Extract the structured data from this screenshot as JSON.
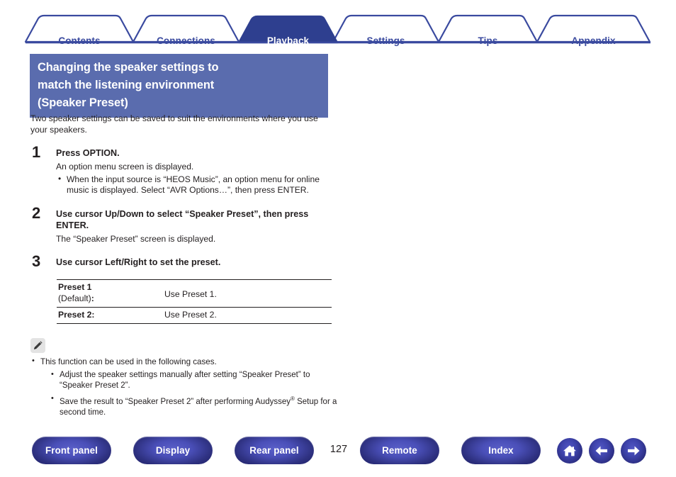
{
  "tabs": [
    {
      "label": "Contents",
      "active": false
    },
    {
      "label": "Connections",
      "active": false
    },
    {
      "label": "Playback",
      "active": true
    },
    {
      "label": "Settings",
      "active": false
    },
    {
      "label": "Tips",
      "active": false
    },
    {
      "label": "Appendix",
      "active": false
    }
  ],
  "title": {
    "line1": "Changing the speaker settings to",
    "line2": "match the listening environment",
    "line3": "(Speaker Preset)"
  },
  "intro": "Two speaker settings can be saved to suit the environments where you use your speakers.",
  "steps": [
    {
      "number": "1",
      "heading": "Press OPTION.",
      "sub": "An option menu screen is displayed.",
      "bullets": [
        "When the input source is “HEOS Music”, an option menu for online music is displayed. Select “AVR Options…”, then press ENTER."
      ]
    },
    {
      "number": "2",
      "heading": "Use cursor Up/Down to select “Speaker Preset”, then press ENTER.",
      "sub": "The “Speaker Preset” screen is displayed.",
      "bullets": []
    },
    {
      "number": "3",
      "heading": "Use cursor Left/Right to set the preset.",
      "sub": "",
      "bullets": []
    }
  ],
  "preset_table": {
    "rows": [
      {
        "key_bold": "Preset 1",
        "key_regular": "(Default)",
        "key_suffix": ":",
        "value": "Use Preset 1."
      },
      {
        "key_bold": "Preset 2:",
        "key_regular": "",
        "key_suffix": "",
        "value": "Use Preset 2."
      }
    ]
  },
  "note": {
    "icon": "pencil-icon",
    "lead": "This function can be used in the following cases.",
    "items": [
      {
        "pre": "Adjust the speaker settings manually after setting “Speaker Preset” to “Speaker Preset 2”.",
        "sup": "",
        "post": ""
      },
      {
        "pre": "Save the result to “Speaker Preset 2” after performing Audyssey",
        "sup": "®",
        "post": " Setup for a second time."
      }
    ]
  },
  "footer": {
    "buttons": [
      {
        "label": "Front panel"
      },
      {
        "label": "Display"
      },
      {
        "label": "Rear panel"
      },
      {
        "label": "Remote"
      },
      {
        "label": "Index"
      }
    ],
    "page_number": "127",
    "icons": [
      "home-icon",
      "arrow-left-icon",
      "arrow-right-icon"
    ]
  },
  "colors": {
    "tab_outline": "#3a4a9f",
    "tab_active_bg": "#2e3f8f",
    "title_bg": "#5a6cae",
    "button_blue": "#2e3180",
    "text": "#231f20"
  }
}
